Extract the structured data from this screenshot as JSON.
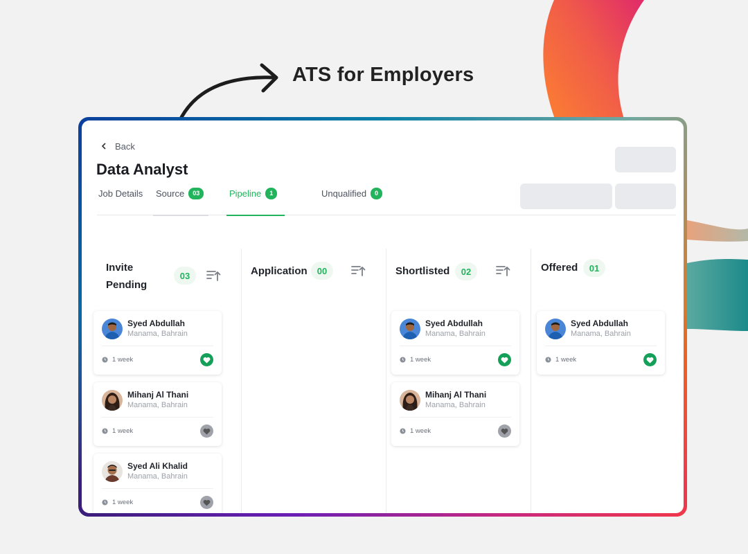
{
  "headline": "ATS for Employers",
  "page": {
    "back_label": "Back",
    "title": "Data Analyst"
  },
  "tabs": [
    {
      "label": "Job Details",
      "badge": ""
    },
    {
      "label": "Source",
      "badge": "03"
    },
    {
      "label": "Pipeline",
      "badge": "1"
    },
    {
      "label": "Unqualified",
      "badge": "0"
    }
  ],
  "columns": [
    {
      "title": "Invite Pending",
      "count": "03"
    },
    {
      "title": "Application",
      "count": "00"
    },
    {
      "title": "Shortlisted",
      "count": "02"
    },
    {
      "title": "Offered",
      "count": "01"
    }
  ],
  "cards": {
    "invite_pending": [
      {
        "name": "Syed Abdullah",
        "location": "Manama, Bahrain",
        "time": "1 week",
        "favorited": true
      },
      {
        "name": "Mihanj Al Thani",
        "location": "Manama, Bahrain",
        "time": "1 week",
        "favorited": false
      },
      {
        "name": "Syed Ali Khalid",
        "location": "Manama, Bahrain",
        "time": "1 week",
        "favorited": false
      }
    ],
    "shortlisted": [
      {
        "name": "Syed Abdullah",
        "location": "Manama, Bahrain",
        "time": "1 week",
        "favorited": true
      },
      {
        "name": "Mihanj Al Thani",
        "location": "Manama, Bahrain",
        "time": "1 week",
        "favorited": false
      }
    ],
    "offered": [
      {
        "name": "Syed Abdullah",
        "location": "Manama, Bahrain",
        "time": "1 week",
        "favorited": true
      }
    ]
  },
  "colors": {
    "accent_green": "#22b45c",
    "heart_green": "#15a05a",
    "heart_gray": "#9fa2a8"
  },
  "icons": {
    "back": "chevron-left-icon",
    "sort": "sort-ascending-icon",
    "time": "clock-icon",
    "favorite": "heart-icon",
    "pointer": "curved-arrow-icon"
  }
}
